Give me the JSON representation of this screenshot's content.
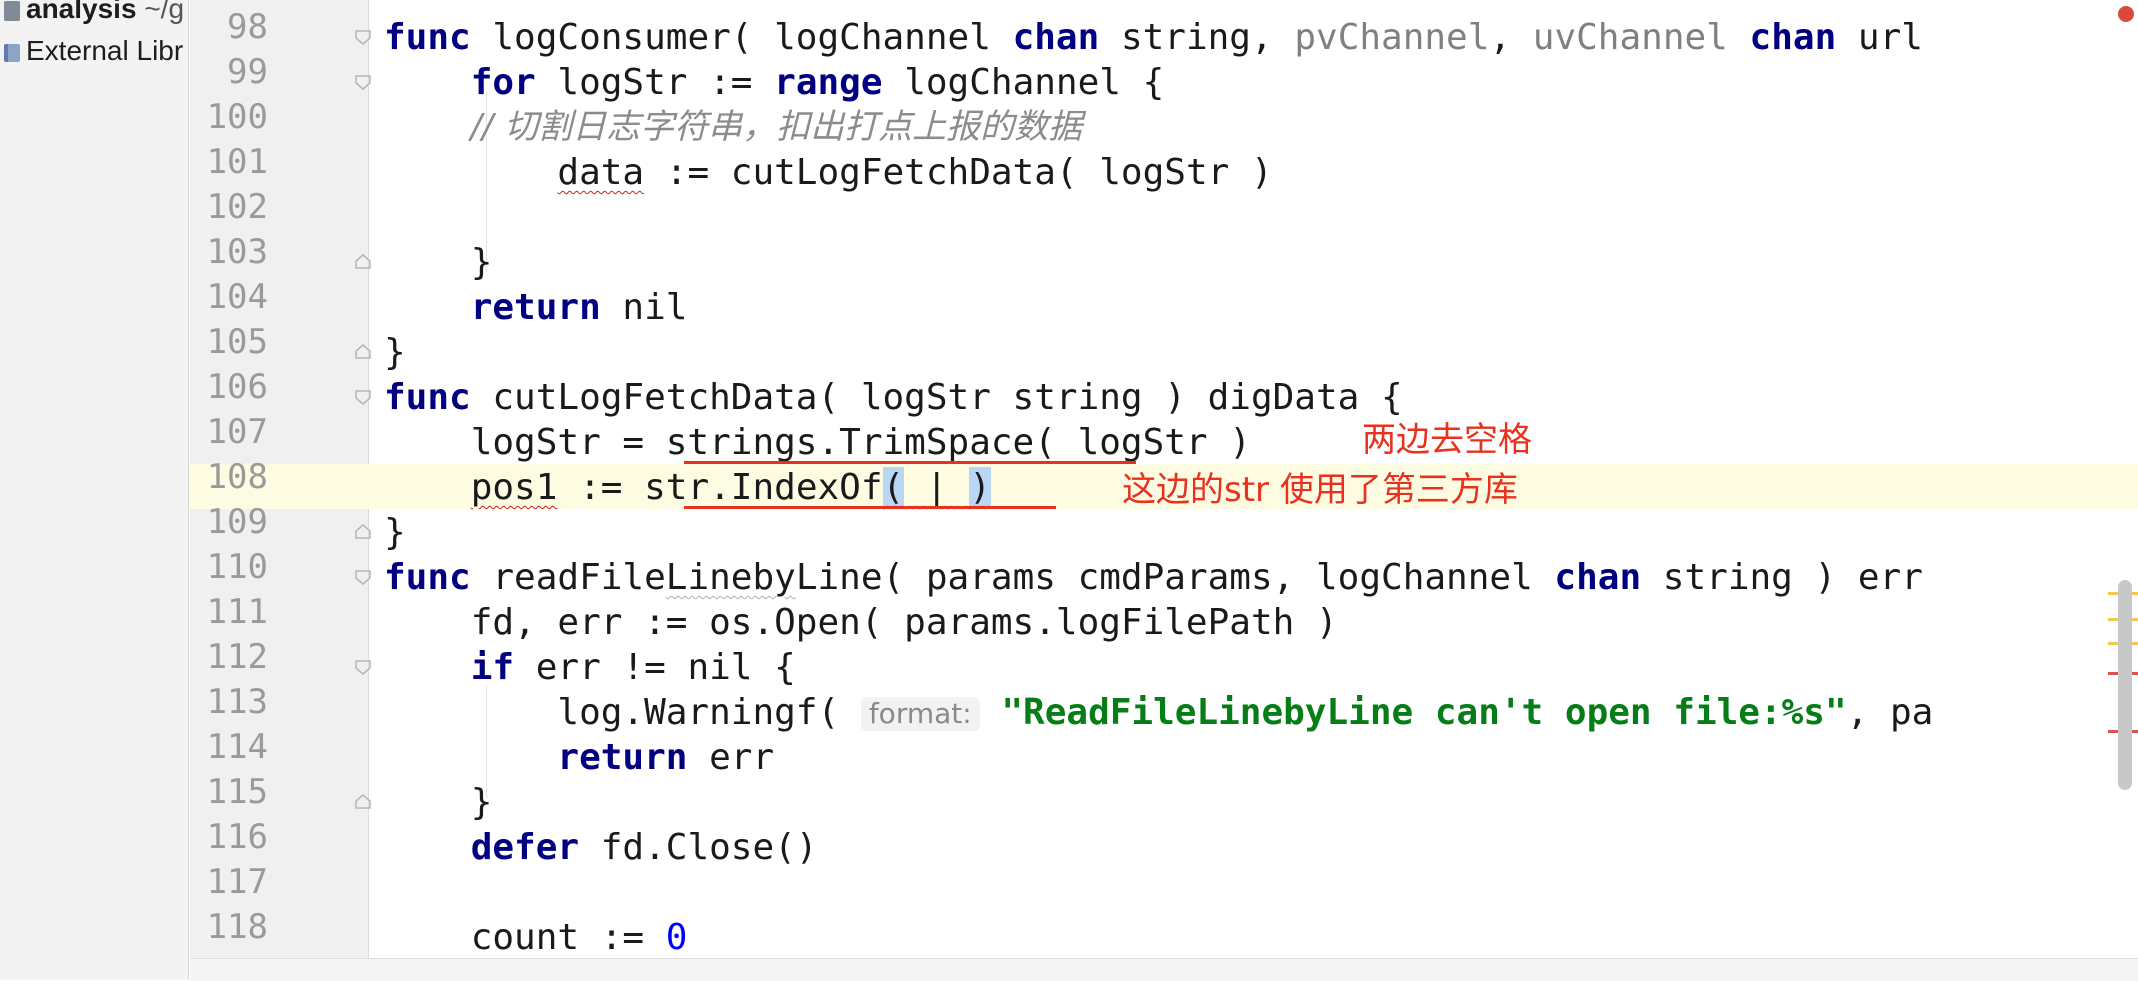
{
  "project": {
    "name": "analysis",
    "path": "~/g",
    "external_libs": "External Libr"
  },
  "editor": {
    "lines": [
      {
        "n": "98"
      },
      {
        "n": "99"
      },
      {
        "n": "100"
      },
      {
        "n": "101"
      },
      {
        "n": "102"
      },
      {
        "n": "103"
      },
      {
        "n": "104"
      },
      {
        "n": "105"
      },
      {
        "n": "106"
      },
      {
        "n": "107"
      },
      {
        "n": "108"
      },
      {
        "n": "109"
      },
      {
        "n": "110"
      },
      {
        "n": "111"
      },
      {
        "n": "112"
      },
      {
        "n": "113"
      },
      {
        "n": "114"
      },
      {
        "n": "115"
      },
      {
        "n": "116"
      },
      {
        "n": "117"
      },
      {
        "n": "118"
      }
    ],
    "tokens": {
      "l98": [
        "func",
        " logConsumer( logChannel ",
        "chan",
        " string, ",
        "pvChannel",
        ", ",
        "uvChannel",
        " ",
        "chan",
        " url"
      ],
      "l99": [
        "    ",
        "for",
        " logStr := ",
        "range",
        " logChannel {"
      ],
      "l100": [
        "        // 切割日志字符串，扣出打点上报的数据"
      ],
      "l101": [
        "        ",
        "data",
        " := cutLogFetchData( logStr )"
      ],
      "l103": [
        "    }"
      ],
      "l104": [
        "    ",
        "return",
        " nil"
      ],
      "l105": [
        "}"
      ],
      "l106": [
        "func",
        " cutLogFetchData( logStr string ) digData {"
      ],
      "l107": [
        "    logStr = strings.TrimSpace( logStr )"
      ],
      "l108": [
        "    ",
        "pos1",
        " := str.IndexOf",
        "(",
        " | ",
        ")"
      ],
      "l109": [
        "}"
      ],
      "l110": [
        "func",
        " readFile",
        "Lineby",
        "Line( params cmdParams, logChannel ",
        "chan",
        " string ) err"
      ],
      "l111": [
        "    fd, err := os.Open( params.logFilePath )"
      ],
      "l112": [
        "    ",
        "if",
        " err != nil {"
      ],
      "l113": [
        "        log.Warningf( ",
        "format:",
        " ",
        "\"ReadFileLinebyLine can't open file:%s\"",
        ", pa"
      ],
      "l114": [
        "        ",
        "return",
        " err"
      ],
      "l115": [
        "    }"
      ],
      "l116": [
        "    ",
        "defer",
        " fd.Close()"
      ],
      "l118": [
        "    count := ",
        "0"
      ]
    }
  },
  "annotations": {
    "trim": "两边去空格",
    "third_party": "这边的str 使用了第三方库"
  },
  "colors": {
    "keyword": "#000080",
    "string": "#067d17",
    "number": "#0000ff",
    "annotation": "#e8321e",
    "current_line": "#fefbe3"
  }
}
